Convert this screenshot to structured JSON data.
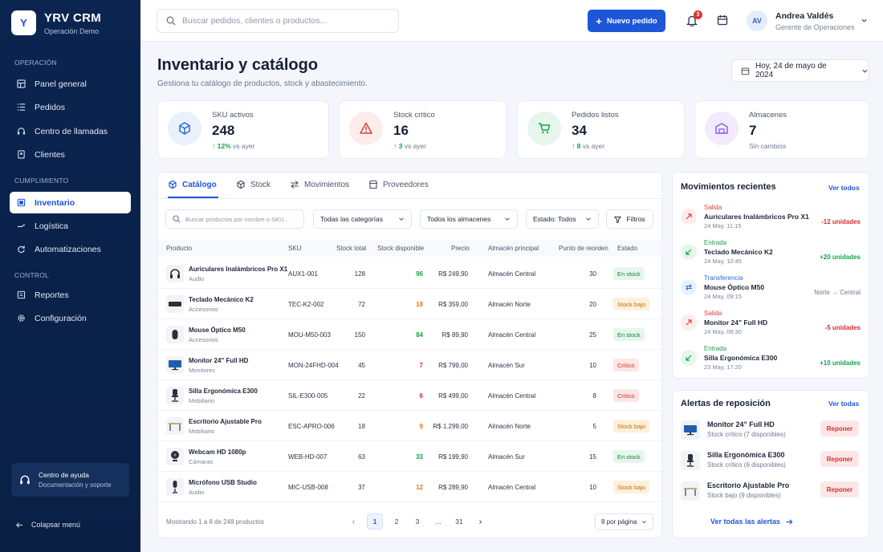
{
  "app": {
    "name": "YRV CRM",
    "subtitle": "Operación Demo",
    "logo_letter": "Y"
  },
  "sidebar": {
    "sections": [
      "OPERACIÓN",
      "CUMPLIMIENTO",
      "CONTROL"
    ],
    "items": [
      {
        "label": "Panel general",
        "icon": "dashboard-icon"
      },
      {
        "label": "Pedidos",
        "icon": "list-icon"
      },
      {
        "label": "Centro de llamadas",
        "icon": "headset-icon"
      },
      {
        "label": "Clientes",
        "icon": "contact-icon"
      },
      {
        "label": "Inventario",
        "icon": "box-icon",
        "active": true
      },
      {
        "label": "Logística",
        "icon": "truck-icon"
      },
      {
        "label": "Automatizaciones",
        "icon": "refresh-icon"
      },
      {
        "label": "Reportes",
        "icon": "report-icon"
      },
      {
        "label": "Configuración",
        "icon": "gear-icon"
      }
    ],
    "help": {
      "title": "Centro de ayuda",
      "subtitle": "Documentación y soporte"
    },
    "collapse": "Colapsar menú"
  },
  "topbar": {
    "search_placeholder": "Buscar pedidos, clientes o productos...",
    "new_order": "Nuevo pedido",
    "notifications": "3",
    "user": {
      "initials": "AV",
      "name": "Andrea Valdés",
      "role": "Gerente de Operaciones"
    }
  },
  "page": {
    "title": "Inventario y catálogo",
    "subtitle": "Gestiona tu catálogo de productos, stock y abastecimiento.",
    "date": "Hoy, 24 de mayo de 2024"
  },
  "kpis": [
    {
      "label": "SKU activos",
      "value": "248",
      "delta": "↑ 12%",
      "delta_text": "vs ayer",
      "color": "#2f6ad9",
      "bg": "#eaf1fc"
    },
    {
      "label": "Stock crítico",
      "value": "16",
      "delta": "↑ 3",
      "delta_text": "vs ayer",
      "color": "#e0403a",
      "bg": "#fdecec"
    },
    {
      "label": "Pedidos listos",
      "value": "34",
      "delta": "↑ 8",
      "delta_text": "vs ayer",
      "color": "#16a34a",
      "bg": "#e6f6ec"
    },
    {
      "label": "Almacenes",
      "value": "7",
      "delta": "",
      "delta_text": "Sin cambios",
      "color": "#8b5cf6",
      "bg": "#f1ebfd"
    }
  ],
  "tabs": [
    "Catálogo",
    "Stock",
    "Movimientos",
    "Proveedores"
  ],
  "filters": {
    "search_placeholder": "Buscar productos por nombre o SKU...",
    "category": "Todas las categorías",
    "warehouse": "Todos los almacenes",
    "status": "Estado: Todos",
    "filters_btn": "Filtros"
  },
  "table": {
    "headers": [
      "Producto",
      "SKU",
      "Stock total",
      "Stock disponible",
      "Precio",
      "Almacén principal",
      "Punto de reorden",
      "Estado"
    ],
    "rows": [
      {
        "name": "Auriculares Inalámbricos Pro X1",
        "cat": "Audio",
        "sku": "AUX1-001",
        "total": "128",
        "avail": "96",
        "avail_color": "#16a34a",
        "price": "R$ 249,90",
        "wh": "Almacén Central",
        "reorder": "30",
        "status": "En stock",
        "cls": "st-ok",
        "icon": "headphones-icon"
      },
      {
        "name": "Teclado Mecánico K2",
        "cat": "Accesorios",
        "sku": "TEC-K2-002",
        "total": "72",
        "avail": "18",
        "avail_color": "#e07a10",
        "price": "R$ 359,00",
        "wh": "Almacén Norte",
        "reorder": "20",
        "status": "Stock bajo",
        "cls": "st-low",
        "icon": "keyboard-icon"
      },
      {
        "name": "Mouse Óptico M50",
        "cat": "Accesorios",
        "sku": "MOU-M50-003",
        "total": "150",
        "avail": "84",
        "avail_color": "#16a34a",
        "price": "R$ 89,90",
        "wh": "Almacén Central",
        "reorder": "25",
        "status": "En stock",
        "cls": "st-ok",
        "icon": "mouse-icon"
      },
      {
        "name": "Monitor 24\" Full HD",
        "cat": "Monitores",
        "sku": "MON-24FHD-004",
        "total": "45",
        "avail": "7",
        "avail_color": "#d22f2f",
        "price": "R$ 799,00",
        "wh": "Almacén Sur",
        "reorder": "10",
        "status": "Crítico",
        "cls": "st-crit",
        "icon": "monitor-icon"
      },
      {
        "name": "Silla Ergonómica E300",
        "cat": "Mobiliario",
        "sku": "SIL-E300-005",
        "total": "22",
        "avail": "6",
        "avail_color": "#d22f2f",
        "price": "R$ 499,00",
        "wh": "Almacén Central",
        "reorder": "8",
        "status": "Crítico",
        "cls": "st-crit",
        "icon": "chair-icon"
      },
      {
        "name": "Escritorio Ajustable Pro",
        "cat": "Mobiliario",
        "sku": "ESC-APRO-006",
        "total": "18",
        "avail": "9",
        "avail_color": "#e07a10",
        "price": "R$ 1.299,00",
        "wh": "Almacén Norte",
        "reorder": "5",
        "status": "Stock bajo",
        "cls": "st-low",
        "icon": "desk-icon"
      },
      {
        "name": "Webcam HD 1080p",
        "cat": "Cámaras",
        "sku": "WEB-HD-007",
        "total": "63",
        "avail": "33",
        "avail_color": "#16a34a",
        "price": "R$ 199,90",
        "wh": "Almacén Sur",
        "reorder": "15",
        "status": "En stock",
        "cls": "st-ok",
        "icon": "webcam-icon"
      },
      {
        "name": "Micrófono USB Studio",
        "cat": "Audio",
        "sku": "MIC-USB-008",
        "total": "37",
        "avail": "12",
        "avail_color": "#e07a10",
        "price": "R$ 289,90",
        "wh": "Almacén Central",
        "reorder": "10",
        "status": "Stock bajo",
        "cls": "st-low",
        "icon": "microphone-icon"
      }
    ],
    "footer": "Mostrando 1 a 8 de 248 productos",
    "pages": [
      "1",
      "2",
      "3",
      "...",
      "31"
    ],
    "per_page": "8 por página"
  },
  "movements": {
    "title": "Movimientos recientes",
    "see_all": "Ver todos",
    "items": [
      {
        "type": "Salida",
        "name": "Auriculares Inalámbricos Pro X1",
        "date": "24 May, 11:15",
        "qty": "-12 unidades",
        "color": "#e0403a",
        "bg": "#fdecec",
        "qcolor": "#d22f2f"
      },
      {
        "type": "Entrada",
        "name": "Teclado Mecánico K2",
        "date": "24 May, 10:45",
        "qty": "+20 unidades",
        "color": "#16a34a",
        "bg": "#e6f6ec",
        "qcolor": "#16a34a"
      },
      {
        "type": "Transferencia",
        "name": "Mouse Óptico M50",
        "date": "24 May, 09:15",
        "qty": "Norte → Central",
        "color": "#2f6ad9",
        "bg": "#eaf1fc",
        "qcolor": "#6e7890"
      },
      {
        "type": "Salida",
        "name": "Monitor 24\" Full HD",
        "date": "24 May, 08:30",
        "qty": "-5 unidades",
        "color": "#e0403a",
        "bg": "#fdecec",
        "qcolor": "#d22f2f"
      },
      {
        "type": "Entrada",
        "name": "Silla Ergonómica E300",
        "date": "23 May, 17:20",
        "qty": "+10 unidades",
        "color": "#16a34a",
        "bg": "#e6f6ec",
        "qcolor": "#16a34a"
      }
    ]
  },
  "alerts": {
    "title": "Alertas de reposición",
    "see_all": "Ver todas",
    "button": "Reponer",
    "items": [
      {
        "name": "Monitor 24\" Full HD",
        "sub": "Stock crítico (7 disponibles)",
        "icon": "monitor-icon"
      },
      {
        "name": "Silla Ergonómica E300",
        "sub": "Stock crítico (6 disponibles)",
        "icon": "chair-icon"
      },
      {
        "name": "Escritorio Ajustable Pro",
        "sub": "Stock bajo (9 disponibles)",
        "icon": "desk-icon"
      }
    ],
    "all_link": "Ver todas las alertas"
  }
}
